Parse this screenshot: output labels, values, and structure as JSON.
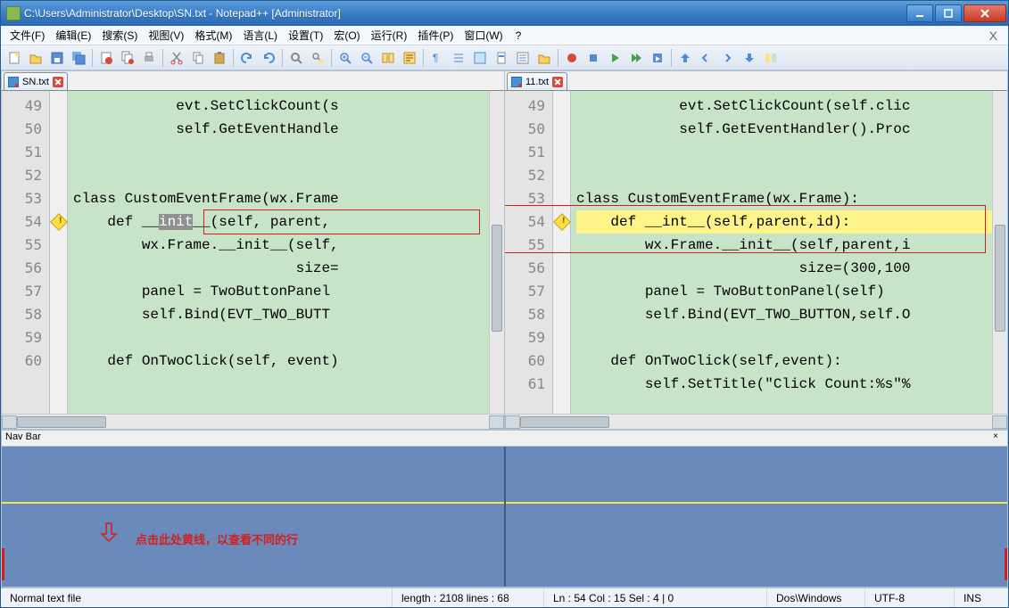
{
  "title": "C:\\Users\\Administrator\\Desktop\\SN.txt - Notepad++ [Administrator]",
  "menu": [
    "文件(F)",
    "编辑(E)",
    "搜索(S)",
    "视图(V)",
    "格式(M)",
    "语言(L)",
    "设置(T)",
    "宏(O)",
    "运行(R)",
    "插件(P)",
    "窗口(W)"
  ],
  "menu_help": "?",
  "tabs": {
    "left": "SN.txt",
    "right": "11.txt"
  },
  "left": {
    "lines": [
      "49",
      "50",
      "51",
      "52",
      "53",
      "54",
      "55",
      "56",
      "57",
      "58",
      "59",
      "60"
    ],
    "code": [
      "            evt.SetClickCount(s",
      "            self.GetEventHandle",
      "",
      "",
      "class CustomEventFrame(wx.Frame",
      "    def __init__(self, parent,",
      "        wx.Frame.__init__(self,",
      "                          size=",
      "        panel = TwoButtonPanel",
      "        self.Bind(EVT_TWO_BUTT",
      "",
      "    def OnTwoClick(self, event)"
    ],
    "warn_line": 5,
    "hl_word": "init"
  },
  "right": {
    "lines": [
      "49",
      "50",
      "51",
      "52",
      "53",
      "54",
      "55",
      "56",
      "57",
      "58",
      "59",
      "60",
      "61"
    ],
    "code": [
      "            evt.SetClickCount(self.clic",
      "            self.GetEventHandler().Proc",
      "",
      "",
      "class CustomEventFrame(wx.Frame):",
      "    def __int__(self,parent,id):",
      "        wx.Frame.__init__(self,parent,i",
      "                          size=(300,100",
      "        panel = TwoButtonPanel(self)",
      "        self.Bind(EVT_TWO_BUTTON,self.O",
      "",
      "    def OnTwoClick(self,event):",
      "        self.SetTitle(\"Click Count:%s\"%"
    ],
    "warn_line": 5
  },
  "navbar_label": "Nav Bar",
  "nav_hint": "点击此处黄线，以查看不同的行",
  "status": {
    "doctype": "Normal text file",
    "length": "length : 2108    lines : 68",
    "pos": "Ln : 54    Col : 15    Sel : 4 | 0",
    "eol": "Dos\\Windows",
    "enc": "UTF-8",
    "ins": "INS"
  }
}
